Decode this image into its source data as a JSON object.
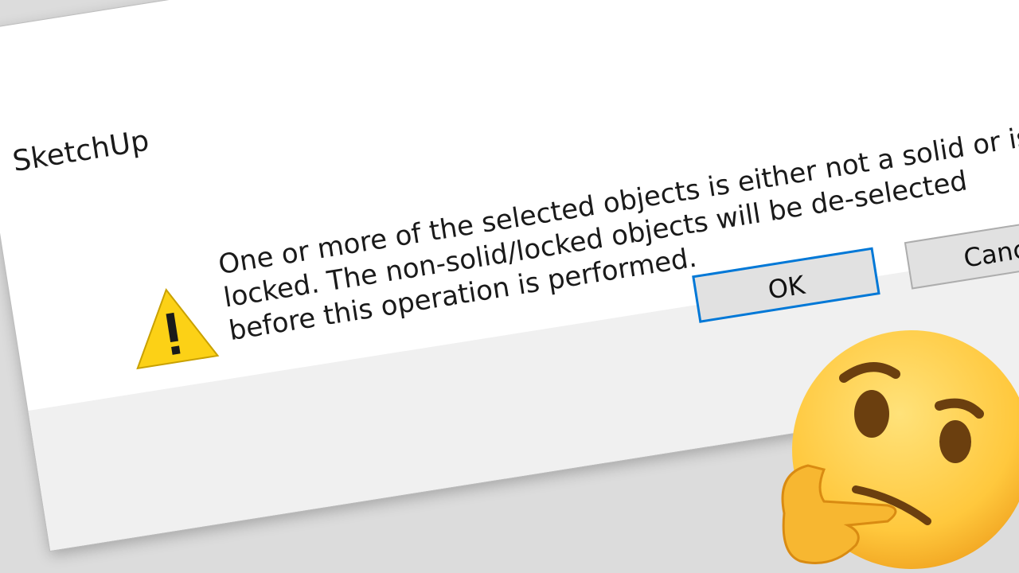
{
  "dialog": {
    "title": "SketchUp",
    "message": "One or more of the selected objects is either not a solid or is\nlocked. The non-solid/locked objects will be de-selected\nbefore this operation is performed.",
    "ok_label": "OK",
    "cancel_label": "Cancel",
    "close_glyph": "✕"
  },
  "colors": {
    "logo_red": "#e8262b",
    "ok_border": "#0078d7",
    "warning_yellow": "#fcd116",
    "emoji_yellow": "#ffc83d"
  },
  "icons": [
    "sketchup-logo-icon",
    "warning-icon",
    "thinking-face-icon"
  ]
}
